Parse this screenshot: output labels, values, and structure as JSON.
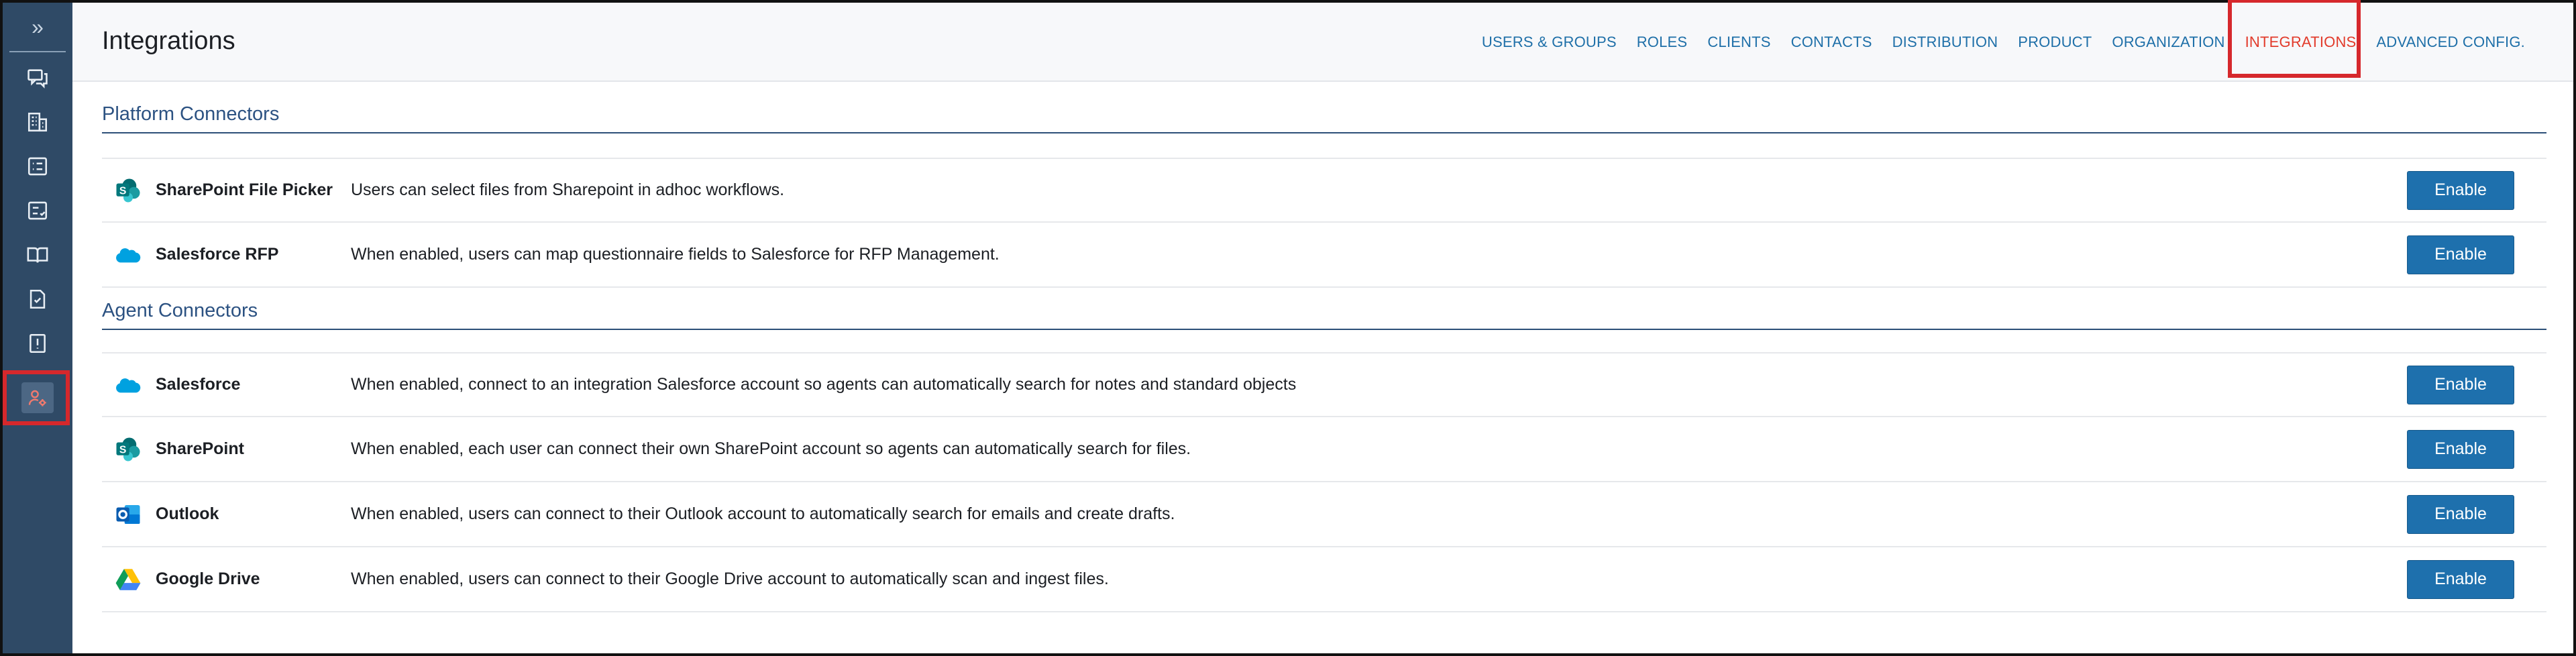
{
  "sidebar": {
    "expand_icon": "double-chevron-right-icon",
    "items": [
      {
        "icon": "chat-icon"
      },
      {
        "icon": "building-icon"
      },
      {
        "icon": "list-icon"
      },
      {
        "icon": "checklist-icon"
      },
      {
        "icon": "book-icon"
      },
      {
        "icon": "document-check-icon"
      },
      {
        "icon": "alert-document-icon"
      },
      {
        "icon": "user-settings-icon",
        "active": true
      }
    ]
  },
  "header": {
    "title": "Integrations",
    "nav": [
      {
        "label": "USERS & GROUPS"
      },
      {
        "label": "ROLES"
      },
      {
        "label": "CLIENTS"
      },
      {
        "label": "CONTACTS"
      },
      {
        "label": "DISTRIBUTION"
      },
      {
        "label": "PRODUCT"
      },
      {
        "label": "ORGANIZATION"
      },
      {
        "label": "INTEGRATIONS",
        "active": true
      },
      {
        "label": "ADVANCED CONFIG."
      }
    ]
  },
  "sections": [
    {
      "title": "Platform Connectors",
      "rows": [
        {
          "icon": "sharepoint-icon",
          "name": "SharePoint File Picker",
          "description": "Users can select files from Sharepoint in adhoc workflows.",
          "button": "Enable"
        },
        {
          "icon": "salesforce-icon",
          "name": "Salesforce RFP",
          "description": "When enabled, users can map questionnaire fields to Salesforce for RFP Management.",
          "button": "Enable"
        }
      ]
    },
    {
      "title": "Agent Connectors",
      "rows": [
        {
          "icon": "salesforce-icon",
          "name": "Salesforce",
          "description": "When enabled, connect to an integration Salesforce account so agents can automatically search for notes and standard objects",
          "button": "Enable"
        },
        {
          "icon": "sharepoint-icon",
          "name": "SharePoint",
          "description": "When enabled, each user can connect their own SharePoint account so agents can automatically search for files.",
          "button": "Enable"
        },
        {
          "icon": "outlook-icon",
          "name": "Outlook",
          "description": "When enabled, users can connect to their Outlook account to automatically search for emails and create drafts.",
          "button": "Enable"
        },
        {
          "icon": "google-drive-icon",
          "name": "Google Drive",
          "description": "When enabled, users can connect to their Google Drive account to automatically scan and ingest files.",
          "button": "Enable"
        }
      ]
    }
  ],
  "colors": {
    "sidebar_bg": "#2f4a66",
    "accent": "#1e70ad",
    "nav_link": "#1e6fa8",
    "nav_active": "#e23b2b",
    "highlight_box": "#d6282c",
    "section_title": "#2c5282"
  }
}
